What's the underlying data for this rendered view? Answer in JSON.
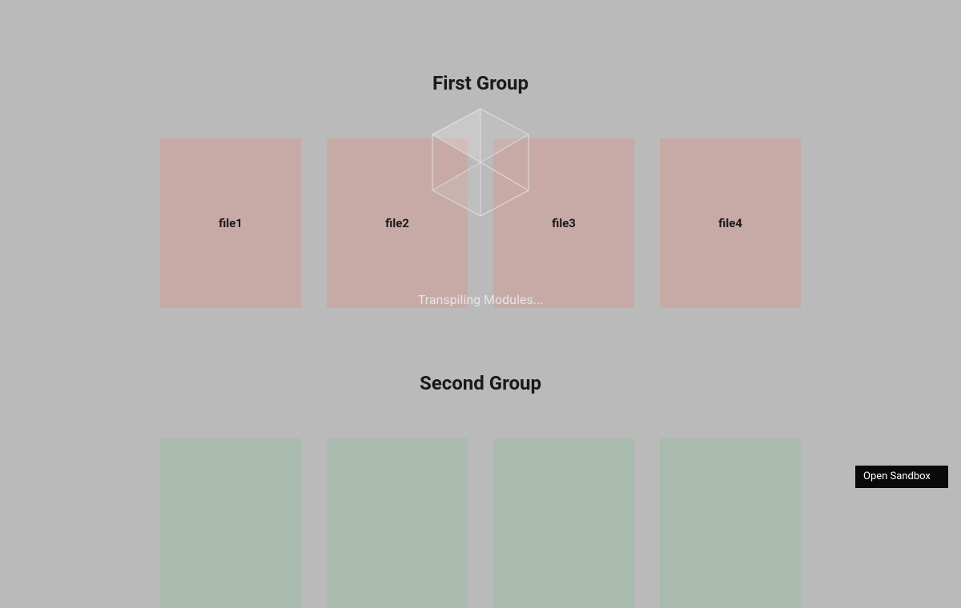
{
  "groups": [
    {
      "title": "First Group",
      "color": "pink",
      "cards": [
        {
          "label": "file1"
        },
        {
          "label": "file2"
        },
        {
          "label": "file3"
        },
        {
          "label": "file4"
        }
      ]
    },
    {
      "title": "Second Group",
      "color": "green",
      "cards": [
        {
          "label": ""
        },
        {
          "label": ""
        },
        {
          "label": ""
        },
        {
          "label": ""
        }
      ]
    }
  ],
  "overlay": {
    "status_text": "Transpiling Modules..."
  },
  "sandbox": {
    "button_label": "Open Sandbox"
  }
}
